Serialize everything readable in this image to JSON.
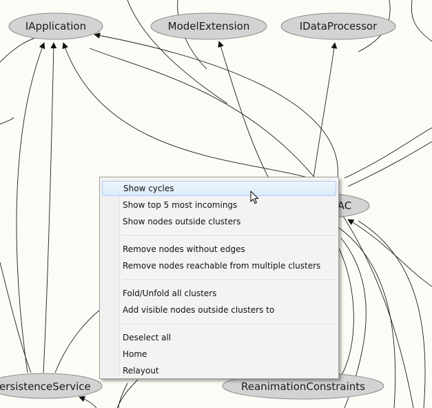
{
  "graph": {
    "nodes": [
      {
        "id": "iapplication",
        "label": "IApplication"
      },
      {
        "id": "modelextension",
        "label": "ModelExtension"
      },
      {
        "id": "idataprocessor",
        "label": "IDataProcessor"
      },
      {
        "id": "central",
        "label": "AC"
      },
      {
        "id": "persistenceservice",
        "label": "ersistenceService"
      },
      {
        "id": "reanimationconstraints",
        "label": "ReanimationConstraints"
      }
    ],
    "colors": {
      "background": "#fcfcf6",
      "node_fill": "#d3d3d3",
      "edge": "#1a1a1a"
    }
  },
  "context_menu": {
    "highlighted_item": "Show cycles",
    "items": [
      "Show cycles",
      "Show top 5 most incomings",
      "Show nodes outside clusters",
      "Remove nodes without edges",
      "Remove nodes reachable from multiple clusters",
      "Fold/Unfold all clusters",
      "Add visible nodes outside clusters to",
      "Deselect all",
      "Home",
      "Relayout"
    ]
  },
  "cursor": {
    "icon": "arrow-cursor-icon"
  }
}
